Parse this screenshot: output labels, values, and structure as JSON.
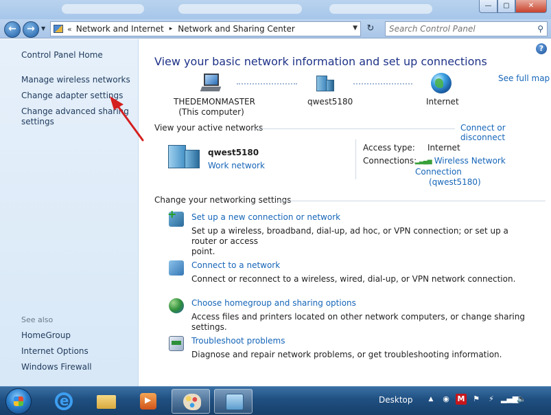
{
  "window": {
    "controls": {
      "minimize": "—",
      "maximize": "▢",
      "close": "✕"
    }
  },
  "address": {
    "crumbs": [
      "Network and Internet",
      "Network and Sharing Center"
    ],
    "chevron": "«",
    "separator": "▸",
    "search_placeholder": "Search Control Panel"
  },
  "left_pane": {
    "home": "Control Panel Home",
    "links": [
      "Manage wireless networks",
      "Change adapter settings",
      "Change advanced sharing",
      "settings"
    ],
    "see_also_label": "See also",
    "see_also": [
      "HomeGroup",
      "Internet Options",
      "Windows Firewall"
    ]
  },
  "main": {
    "heading": "View your basic network information and set up connections",
    "see_full_map": "See full map",
    "map": {
      "computer_name": "THEDEMONMASTER",
      "computer_sub": "(This computer)",
      "network_name": "qwest5180",
      "internet": "Internet"
    },
    "active_networks": {
      "label": "View your active networks",
      "connect_link": "Connect or disconnect",
      "network_name": "qwest5180",
      "network_type": "Work network",
      "access_type_label": "Access type:",
      "access_type_value": "Internet",
      "connections_label": "Connections:",
      "connection_value_1": "Wireless Network Connection",
      "connection_value_2": "(qwest5180)"
    },
    "settings": {
      "label": "Change your networking settings",
      "tasks": [
        {
          "title": "Set up a new connection or network",
          "desc1": "Set up a wireless, broadband, dial-up, ad hoc, or VPN connection; or set up a router or access",
          "desc2": "point."
        },
        {
          "title": "Connect to a network",
          "desc1": "Connect or reconnect to a wireless, wired, dial-up, or VPN network connection."
        },
        {
          "title": "Choose homegroup and sharing options",
          "desc1": "Access files and printers located on other network computers, or change sharing settings."
        },
        {
          "title": "Troubleshoot problems",
          "desc1": "Diagnose and repair network problems, or get troubleshooting information."
        }
      ]
    }
  },
  "taskbar": {
    "desktop_label": "Desktop",
    "mcafee_letter": "M"
  },
  "colors": {
    "link": "#1565b8",
    "heading": "#1e3287",
    "left_pane_bg": "#dde9f7",
    "taskbar": "#1f4f81",
    "annotation_arrow": "#d42020"
  }
}
